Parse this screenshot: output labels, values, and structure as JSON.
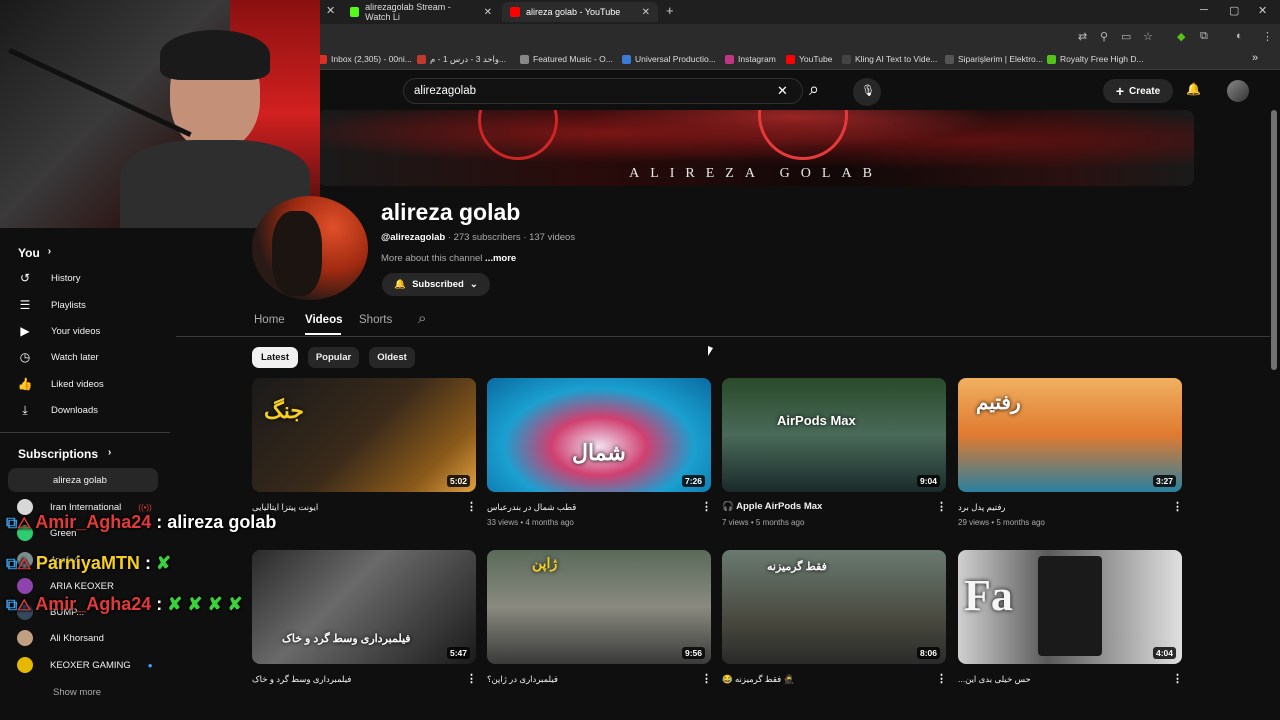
{
  "browser": {
    "tabs": [
      {
        "label": "alirezagolab Stream - Watch Li",
        "icon": "kick-icon",
        "color": "#53fc18"
      },
      {
        "label": "alireza golab - YouTube",
        "icon": "youtube-icon",
        "color": "#ff0000"
      }
    ],
    "new_tab": "+",
    "window_controls": [
      "─",
      "▢",
      "✕"
    ],
    "bookmarks": [
      {
        "label": "Inbox (2,305) - 00ni...",
        "color": "#d93025"
      },
      {
        "label": "واحد 3 - درس 1 - م...",
        "color": "#c0392b"
      },
      {
        "label": "Featured Music - O...",
        "color": "#888888"
      },
      {
        "label": "Universal Productio...",
        "color": "#3a7bd5"
      },
      {
        "label": "Instagram",
        "color": "#c13584"
      },
      {
        "label": "YouTube",
        "color": "#ff0000"
      },
      {
        "label": "Kling AI Text to Vide...",
        "color": "#444444"
      },
      {
        "label": "Siparişlerim | Elektro...",
        "color": "#555555"
      },
      {
        "label": "Royalty Free High D...",
        "color": "#53c21b"
      }
    ],
    "bookmarks_more": "»"
  },
  "header": {
    "search_value": "alirezagolab",
    "clear_icon": "✕",
    "search_icon": "⌕",
    "mic_icon": "🎙",
    "create_label": "Create",
    "create_icon": "+",
    "bell_icon": "🔔"
  },
  "banner": {
    "text": "ALIREZA GOLAB"
  },
  "channel": {
    "name": "alireza golab",
    "handle": "@alirezagolab",
    "stats": "· 273 subscribers · 137 videos",
    "about": "More about this channel",
    "more": "...more",
    "subscribed_label": "Subscribed",
    "tabs": [
      "Home",
      "Videos",
      "Shorts"
    ],
    "active_tab": "Videos",
    "chips": [
      "Latest",
      "Popular",
      "Oldest"
    ],
    "active_chip": "Latest"
  },
  "sidebar": {
    "you_label": "You",
    "items": [
      {
        "label": "History",
        "icon": "↺"
      },
      {
        "label": "Playlists",
        "icon": "☰"
      },
      {
        "label": "Your videos",
        "icon": "▶"
      },
      {
        "label": "Watch later",
        "icon": "◷"
      },
      {
        "label": "Liked videos",
        "icon": "👍"
      },
      {
        "label": "Downloads",
        "icon": "⤓"
      }
    ],
    "subscriptions_label": "Subscriptions",
    "subscriptions": [
      {
        "label": "alireza golab",
        "color": "#c0392b"
      },
      {
        "label": "Iran International",
        "color": "#d8d8d8"
      },
      {
        "label": "Green",
        "color": "#2ecc71"
      },
      {
        "label": "4pafa4",
        "color": "#7f8c8d"
      },
      {
        "label": "ARIA KEOXER",
        "color": "#8e44ad"
      },
      {
        "label": "BUMP...",
        "color": "#34495e"
      },
      {
        "label": "Ali Khorsand",
        "color": "#c0a080"
      },
      {
        "label": "KEOXER GAMING",
        "color": "#e6b800"
      }
    ],
    "show_more": "Show more"
  },
  "videos": [
    {
      "title": "ایونت پیتزا ایتالیایی",
      "meta": "",
      "duration": "5:02",
      "thumb_text": "جنگ"
    },
    {
      "title": "قطب شمال در بندرعباس",
      "meta": "33 views • 4 months ago",
      "duration": "7:26",
      "thumb_text": "شمال"
    },
    {
      "title": "🎧 Apple AirPods Max",
      "meta": "7 views • 5 months ago",
      "duration": "9:04",
      "thumb_text": "AirPods Max"
    },
    {
      "title": "رفتیم پدل برد",
      "meta": "29 views • 5 months ago",
      "duration": "3:27",
      "thumb_text": "رفتیم"
    },
    {
      "title": "فیلمبرداری وسط گرد و خاک",
      "meta": "",
      "duration": "5:47",
      "thumb_text": "فیلمبرداری وسط گرد و خاک"
    },
    {
      "title": "فیلمبرداری در ژاپن؟",
      "meta": "",
      "duration": "9:56",
      "thumb_text": "ژاپن"
    },
    {
      "title": "😂 فقط گرمیزنه 🥷",
      "meta": "",
      "duration": "8:06",
      "thumb_text": "فقط گرمیزنه"
    },
    {
      "title": "...حس خیلی بدی این",
      "meta": "",
      "duration": "4:04",
      "thumb_text": "Fa"
    }
  ],
  "chat": [
    {
      "user": "Amir_Agha24",
      "sep": " : ",
      "msg": "alireza golab"
    },
    {
      "user": "ParniyaMTN",
      "sep": " : ",
      "msg": "✘"
    },
    {
      "user": "Amir_Agha24",
      "sep": " : ",
      "msg": "✘ ✘ ✘ ✘"
    }
  ]
}
